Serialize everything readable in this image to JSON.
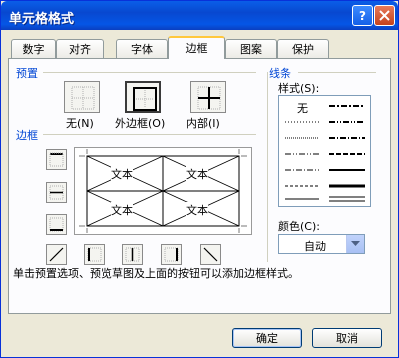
{
  "window": {
    "title": "单元格格式"
  },
  "tabs": [
    "数字",
    "对齐",
    "字体",
    "边框",
    "图案",
    "保护"
  ],
  "active_tab": "边框",
  "presets": {
    "group_label": "预置",
    "none_label": "无(N)",
    "outline_label": "外边框(O)",
    "inside_label": "内部(I)"
  },
  "border": {
    "group_label": "边框",
    "preview_cell_text": "文本"
  },
  "line": {
    "group_label": "线条",
    "style_label": "样式(S):",
    "style_none": "无",
    "color_label": "颜色(C):",
    "color_value": "自动"
  },
  "hint": "单击预置选项、预览草图及上面的按钮可以添加边框样式。",
  "buttons": {
    "ok": "确定",
    "cancel": "取消"
  },
  "colors": {
    "accent": "#0046d5",
    "titlebar": "#0848d0"
  }
}
